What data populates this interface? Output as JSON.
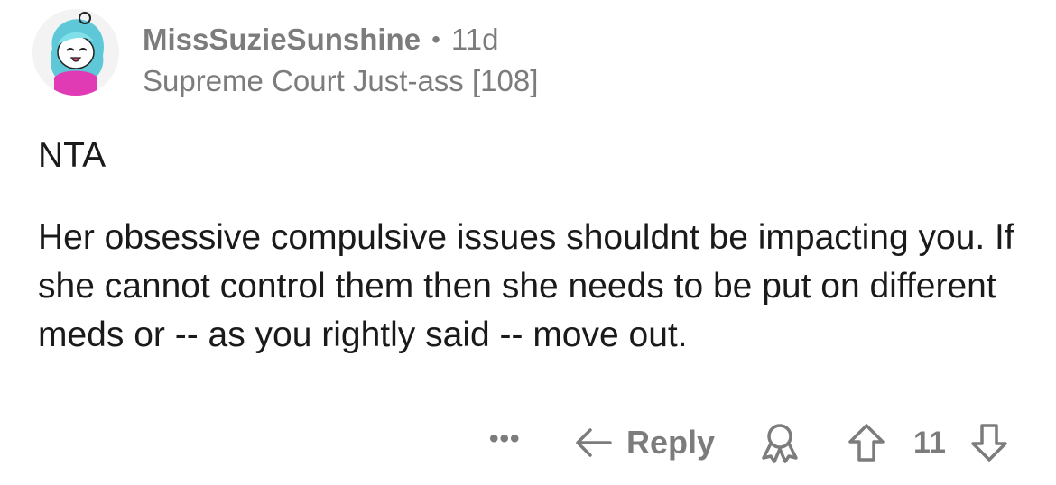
{
  "comment": {
    "username": "MissSuzieSunshine",
    "separator": "•",
    "age": "11d",
    "flair": "Supreme Court Just-ass [108]",
    "body": [
      "NTA",
      "Her obsessive compulsive issues shouldnt be impacting you. If she cannot control them then she needs to be put on different meds or -- as you rightly said -- move out."
    ]
  },
  "actions": {
    "more": "•••",
    "reply_label": "Reply",
    "vote_count": "11"
  },
  "icons": {
    "avatar": "avatar-icon",
    "more": "more-options-icon",
    "reply": "reply-arrow-icon",
    "award": "award-icon",
    "upvote": "upvote-arrow-icon",
    "downvote": "downvote-arrow-icon"
  },
  "colors": {
    "muted_text": "#7c7c7c",
    "body_text": "#1a1a1b",
    "avatar_hair": "#5ec8d8",
    "avatar_shirt": "#e03bb5"
  }
}
